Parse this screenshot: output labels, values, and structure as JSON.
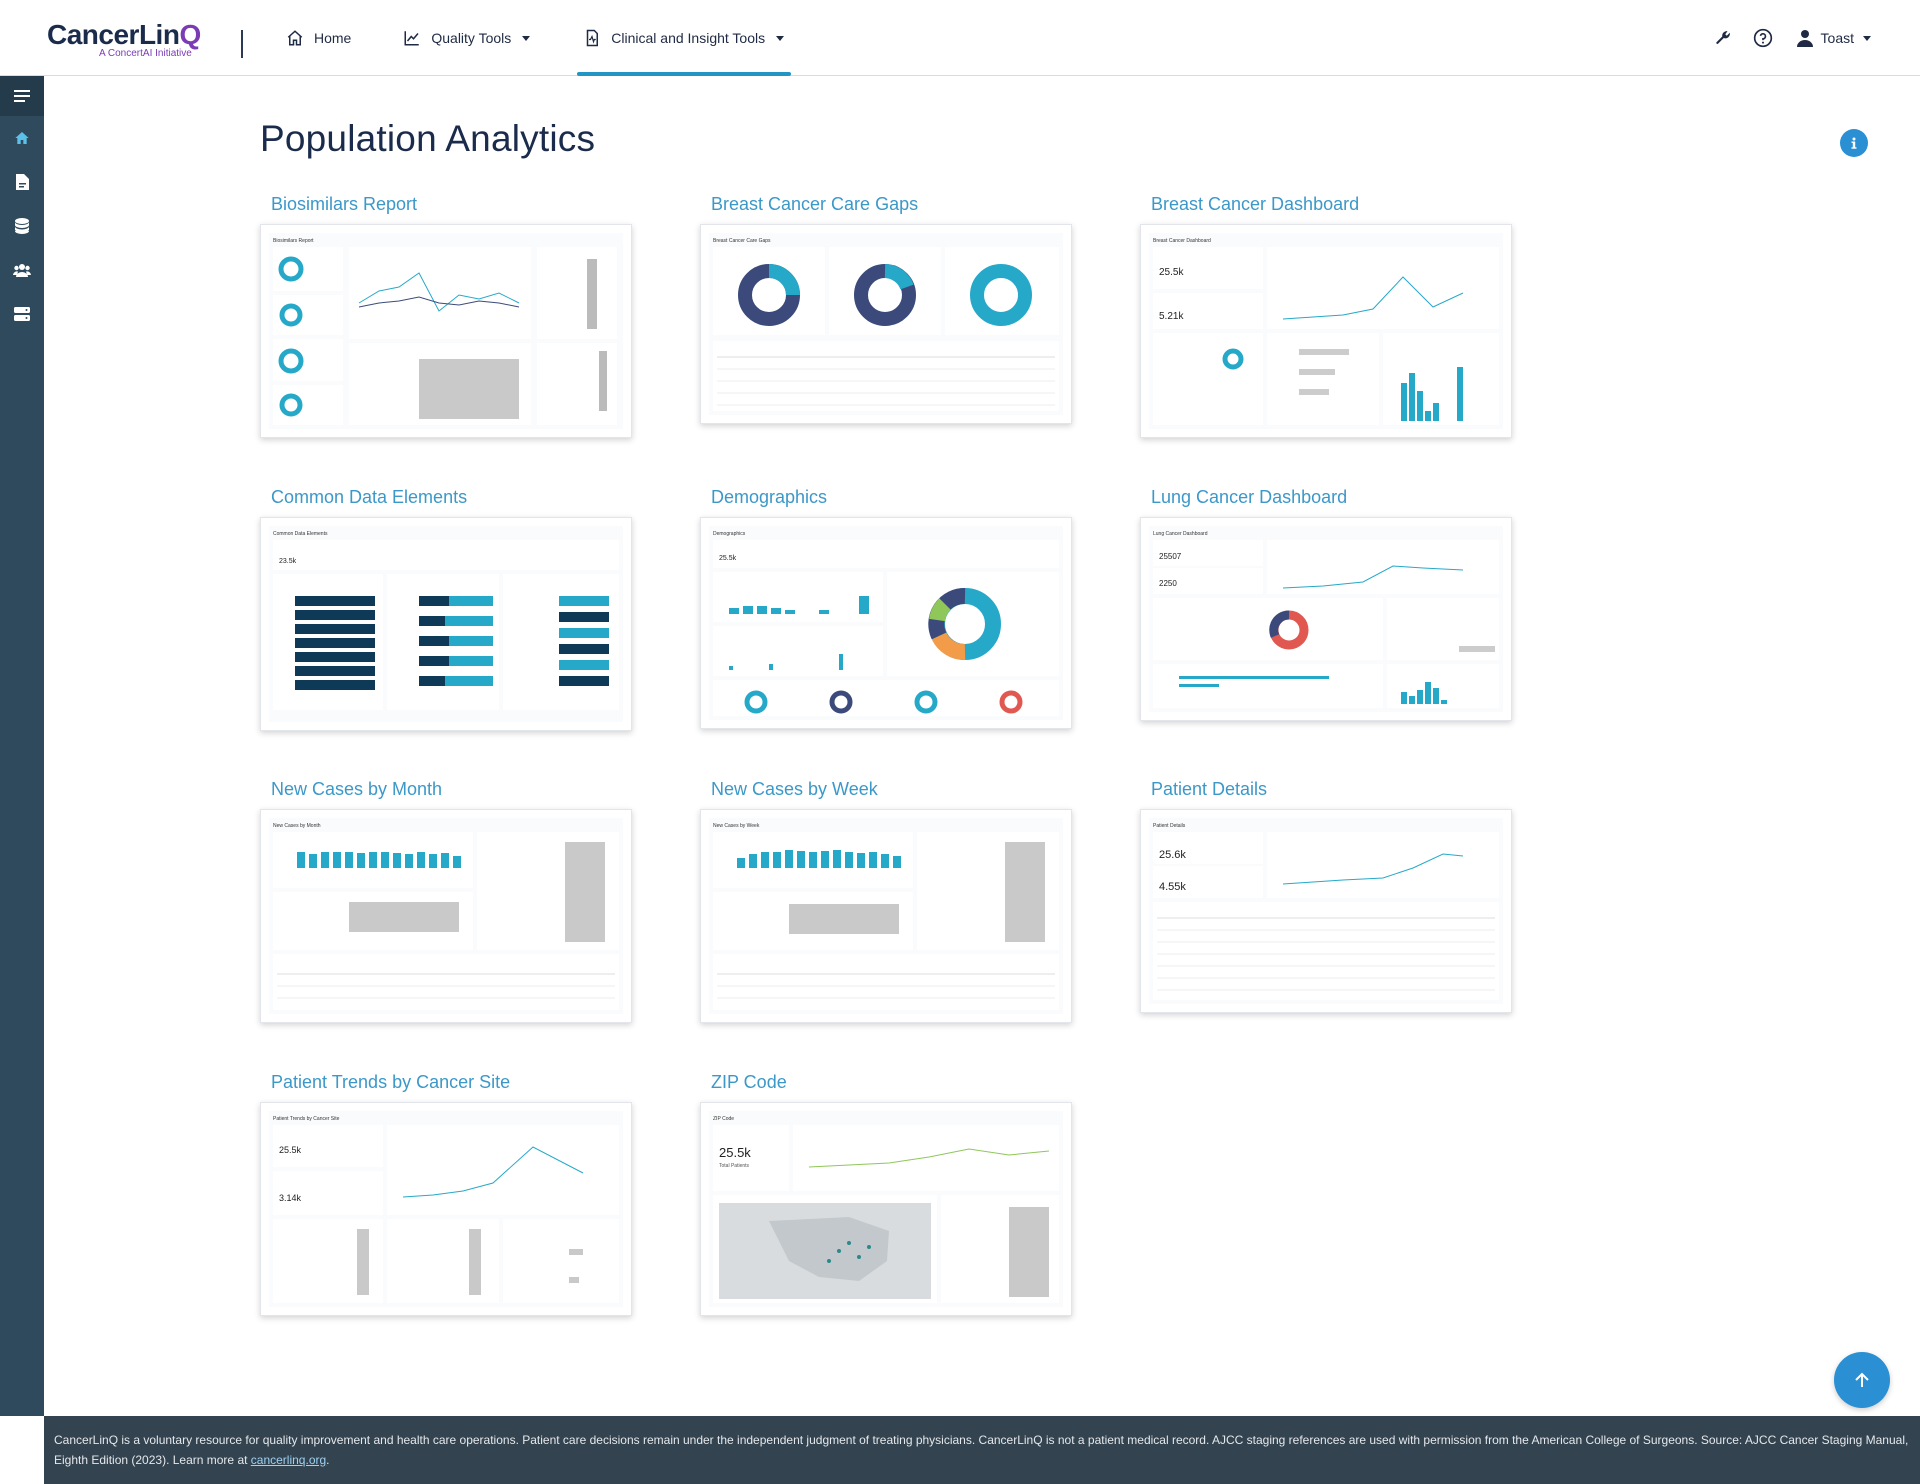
{
  "header": {
    "logo_main_a": "CancerLin",
    "logo_main_b": "Q",
    "logo_sub": "A ConcertAI Initiative",
    "nav": [
      {
        "label": "Home",
        "icon": "home-icon"
      },
      {
        "label": "Quality Tools",
        "icon": "chart-line-icon"
      },
      {
        "label": "Clinical and Insight Tools",
        "icon": "report-icon"
      }
    ],
    "active_nav": "Clinical and Insight Tools",
    "user_name": "Toast"
  },
  "sidebar": {
    "items": [
      "menu-icon",
      "home-icon",
      "document-icon",
      "database-icon",
      "users-icon",
      "server-icon"
    ]
  },
  "main": {
    "title": "Population Analytics",
    "cards": [
      {
        "title": "Biosimilars Report",
        "thumb_title": "Biosimilars Report"
      },
      {
        "title": "Breast Cancer Care Gaps",
        "thumb_title": "Breast Cancer Care Gaps"
      },
      {
        "title": "Breast Cancer Dashboard",
        "thumb_title": "Breast Cancer Dashboard",
        "stat1": "25.5k",
        "stat2": "5.21k"
      },
      {
        "title": "Common Data Elements",
        "thumb_title": "Common Data Elements",
        "stat1": "23.5k"
      },
      {
        "title": "Demographics",
        "thumb_title": "Demographics",
        "stat1": "25.5k"
      },
      {
        "title": "Lung Cancer Dashboard",
        "thumb_title": "Lung Cancer Dashboard",
        "stat1": "25507",
        "stat2": "2250"
      },
      {
        "title": "New Cases by Month",
        "thumb_title": "New Cases by Month"
      },
      {
        "title": "New Cases by Week",
        "thumb_title": "New Cases by Week"
      },
      {
        "title": "Patient Details",
        "thumb_title": "Patient Details",
        "stat1": "25.6k",
        "stat2": "4.55k"
      },
      {
        "title": "Patient Trends by Cancer Site",
        "thumb_title": "Patient Trends by Cancer Site",
        "stat1": "25.5k",
        "stat2": "3.14k"
      },
      {
        "title": "ZIP Code",
        "thumb_title": "ZIP Code",
        "stat1": "25.5k",
        "stat1_sub": "Total Patients"
      }
    ]
  },
  "footer": {
    "text": "CancerLinQ is a voluntary resource for quality improvement and health care operations. Patient care decisions remain under the independent judgment of treating physicians. CancerLinQ is not a patient medical record. AJCC staging references are used with permission from the American College of Surgeons. Source: AJCC Cancer Staging Manual, Eighth Edition (2023). Learn more at ",
    "link": "cancerlinq.org",
    "end": "."
  },
  "colors": {
    "accent": "#2a8fd3",
    "chart_teal": "#26a9c9",
    "chart_navy": "#3b4a7a",
    "sidebar": "#2e4a5c",
    "footer": "#33434f",
    "title_link": "#3b98c9",
    "logo_purple": "#7b3bb5"
  }
}
